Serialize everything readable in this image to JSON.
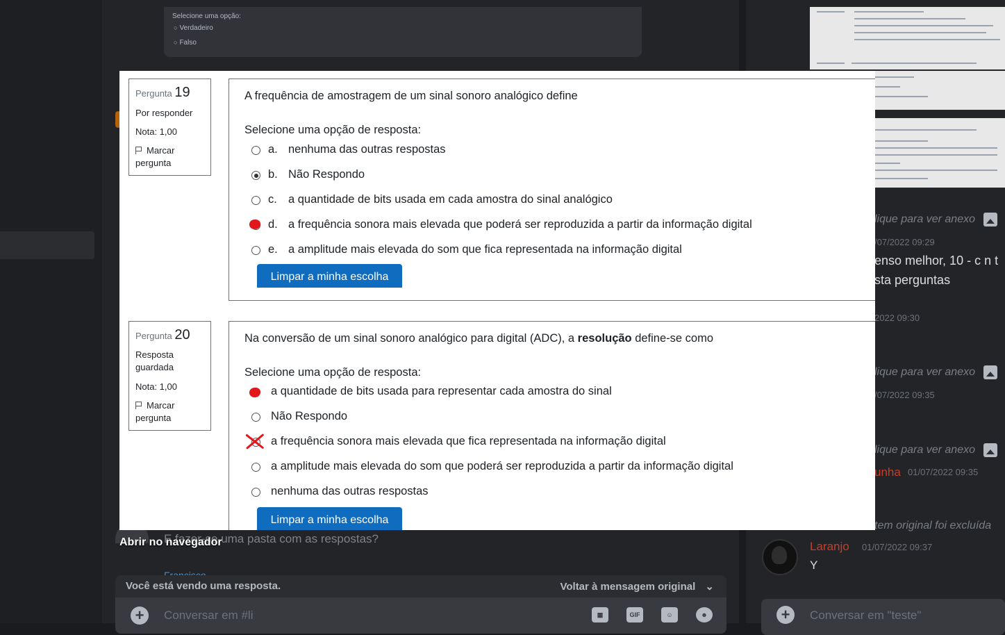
{
  "background": {
    "top_card": {
      "label": "Selecione uma opção:",
      "options": [
        "Verdadeiro",
        "Falso"
      ]
    },
    "right_panel": {
      "attachment_link": "lique para ver anexo",
      "timestamps": [
        "/07/2022 09:29",
        "2022 09:30",
        "/07/2022 09:35",
        "01/07/2022 09:35"
      ],
      "msg_line1": "enso melhor, 10 - c n t",
      "msg_line2": "sta perguntas",
      "name_linha": "unha",
      "deleted_notice": "tem original foi excluída",
      "user_name": "Laranjo",
      "user_timestamp": "01/07/2022 09:37",
      "user_message": "Y",
      "composer_placeholder": "Conversar em \"teste\""
    },
    "main": {
      "message_text": "E fazer-se uma pasta com as respostas?",
      "next_author": "Francisco",
      "open_in_browser": "Abrir no navegador",
      "reply_bar_text": "Você está vendo uma resposta.",
      "reply_back": "Voltar à mensagem original",
      "composer_placeholder": "Conversar em #li",
      "gif_label": "GIF"
    }
  },
  "quiz": {
    "clear_button": "Limpar a minha escolha",
    "prompt": "Selecione uma opção de resposta:",
    "flag_label_1": "Marcar",
    "flag_label_2": "pergunta",
    "question_word": "Pergunta",
    "q19": {
      "number": "19",
      "status": "Por responder",
      "grade": "Nota: 1,00",
      "text": "A frequência de amostragem de um sinal sonoro analógico define",
      "options": [
        {
          "letter": "a.",
          "text": "nenhuma das outras respostas"
        },
        {
          "letter": "b.",
          "text": "Não Respondo"
        },
        {
          "letter": "c.",
          "text": "a quantidade de bits usada em cada amostra do sinal analógico"
        },
        {
          "letter": "d.",
          "text": "a frequência sonora mais elevada que poderá ser reproduzida a partir da informação digital"
        },
        {
          "letter": "e.",
          "text": "a amplitude mais elevada do som que fica representada na informação digital"
        }
      ],
      "selected_index": 1,
      "annotated_index": 3
    },
    "q20": {
      "number": "20",
      "status_1": "Resposta",
      "status_2": "guardada",
      "grade": "Nota: 1,00",
      "text_before": "Na conversão de um sinal sonoro analógico para digital (ADC), a ",
      "text_bold": "resolução",
      "text_after": " define-se como",
      "options": [
        {
          "text": "a quantidade de bits usada para representar cada amostra do sinal"
        },
        {
          "text": "Não Respondo"
        },
        {
          "text": "a frequência sonora mais elevada que fica representada na informação digital"
        },
        {
          "text": "a amplitude mais elevada do som que poderá ser reproduzida a partir da informação digital"
        },
        {
          "text": "nenhuma das outras respostas"
        }
      ],
      "annotated_dot_index": 0,
      "annotated_x_index": 2
    }
  }
}
